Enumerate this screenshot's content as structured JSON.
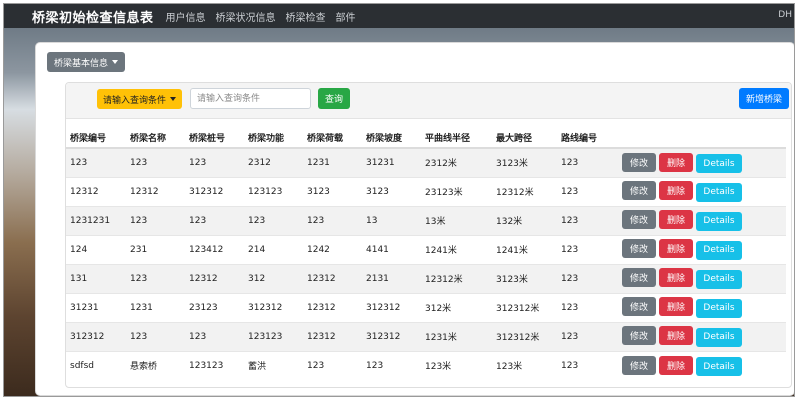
{
  "navbar": {
    "brand": "桥梁初始检查信息表",
    "links": [
      "用户信息",
      "桥梁状况信息",
      "桥梁检查",
      "部件"
    ],
    "right_text": "DH"
  },
  "panel": {
    "basic_info_label": "桥梁基本信息"
  },
  "toolbar": {
    "condition_label": "请输入查询条件",
    "search_placeholder": "请输入查询条件",
    "query_label": "查询",
    "add_label": "新增桥梁"
  },
  "table": {
    "headers": [
      "桥梁编号",
      "桥梁名称",
      "桥梁桩号",
      "桥梁功能",
      "桥梁荷载",
      "桥梁坡度",
      "平曲线半径",
      "最大跨径",
      "路线编号"
    ],
    "rows": [
      [
        "123",
        "123",
        "123",
        "2312",
        "1231",
        "31231",
        "2312米",
        "3123米",
        "123"
      ],
      [
        "12312",
        "12312",
        "312312",
        "123123",
        "3123",
        "3123",
        "23123米",
        "12312米",
        "123"
      ],
      [
        "1231231",
        "123",
        "123",
        "123",
        "123",
        "13",
        "13米",
        "132米",
        "123"
      ],
      [
        "124",
        "231",
        "123412",
        "214",
        "1242",
        "4141",
        "1241米",
        "1241米",
        "123"
      ],
      [
        "131",
        "123",
        "12312",
        "312",
        "12312",
        "2131",
        "12312米",
        "3123米",
        "123"
      ],
      [
        "31231",
        "1231",
        "23123",
        "312312",
        "12312",
        "312312",
        "312米",
        "312312米",
        "123"
      ],
      [
        "312312",
        "123",
        "123",
        "123123",
        "12312",
        "312312",
        "1231米",
        "312312米",
        "123"
      ],
      [
        "sdfsd",
        "悬索桥",
        "123123",
        "蓄洪",
        "123",
        "123",
        "123米",
        "123米",
        "123"
      ]
    ],
    "action_labels": {
      "edit": "修改",
      "delete": "删除",
      "details": "Details"
    }
  },
  "colors": {
    "navbar": "#2b2f33",
    "edit": "#6c757d",
    "delete": "#dc3545",
    "details": "#17c0e8",
    "query": "#28a745",
    "add": "#007bff",
    "condition": "#ffc107"
  }
}
